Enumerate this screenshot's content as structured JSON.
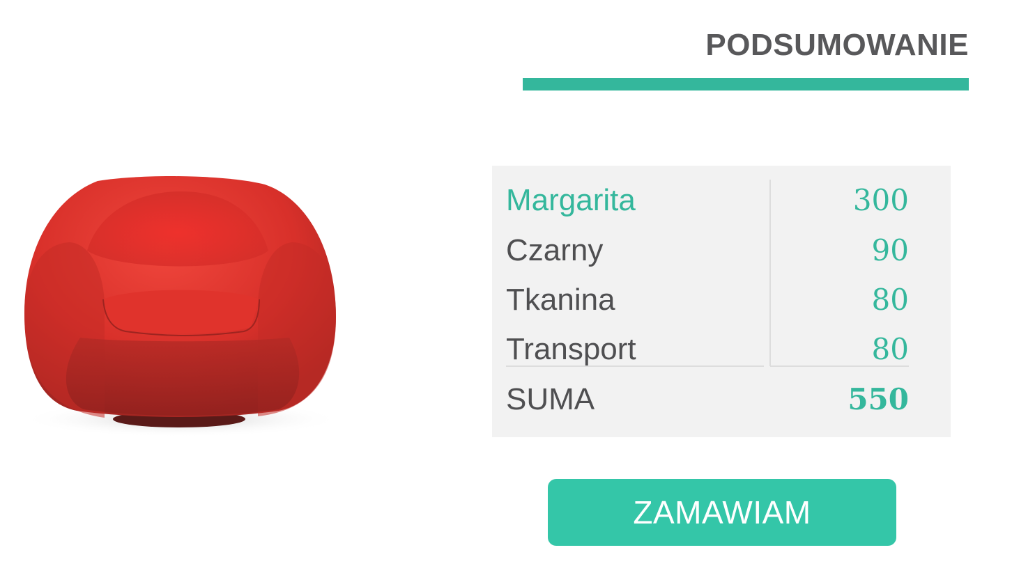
{
  "header": {
    "title": "PODSUMOWANIE"
  },
  "product_image": {
    "subject": "red armchair",
    "color": "#e5312b"
  },
  "summary": {
    "rows": [
      {
        "name": "Margarita",
        "price": "300"
      },
      {
        "name": "Czarny",
        "price": "90"
      },
      {
        "name": "Tkanina",
        "price": "80"
      },
      {
        "name": "Transport",
        "price": "80"
      }
    ],
    "total_label": "SUMA",
    "total_value": "550"
  },
  "order_button": {
    "label": "ZAMAWIAM"
  },
  "colors": {
    "accent": "#34b79c",
    "button": "#34c6a8",
    "text": "#4f4f51",
    "panel_bg": "#f2f2f2"
  }
}
